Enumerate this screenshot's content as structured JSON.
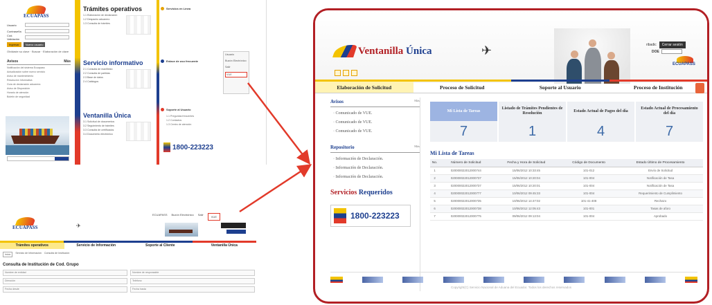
{
  "portal_left": {
    "logo_text": "ECUAPASS",
    "login_labels": [
      "Usuario",
      "Contraseña",
      "Cód. Validación"
    ],
    "buttons": [
      "Ingresar",
      "Nuevo usuario"
    ],
    "hint": "Olvidaste su clave · Buscar · Elaboración de clave",
    "avisos": {
      "title": "Avisos",
      "more": "Más",
      "items": [
        "Notificación del sistema Ecuapass",
        "Actualización sobre nuevo servicio",
        "Aviso de mantenimiento",
        "Resolución Informativa",
        "Guía de declaración aduanera",
        "Aviso de Disposición",
        "Horario de atención",
        "Boletín de seguridad"
      ]
    },
    "sections": [
      {
        "title": "Trámites operativos",
        "items": [
          "1.1 Elaboración de declaración",
          "1.2 Despacho aduanero",
          "1.3 Consulta de trámites"
        ]
      },
      {
        "title": "Servicio informativo",
        "items": [
          "2.1 Consulta de manifiesto",
          "2.2 Consulta de partidas",
          "2.3 Base de datos",
          "2.4 Catálogos"
        ]
      },
      {
        "title": "Ventanilla Única",
        "items": [
          "3.1 Solicitud de documentos",
          "3.2 Seguimiento de trámites",
          "3.3 Consulta de certificados",
          "3.4 Documento electrónico"
        ]
      }
    ],
    "right_col": [
      "Servicios en Línea",
      "Enlace de uso frecuente",
      "Soporte al Usuario",
      "1.1 Preguntas frecuentes",
      "1.2 Contactos",
      "1.3 Centro de atención"
    ],
    "phone": "1800-223223",
    "dropdown": [
      "Usuario",
      "Buzón Electrónico",
      "Salir",
      "VUE"
    ]
  },
  "portal_bottom": {
    "logo_text": "ECUAPASS",
    "login_items": [
      "ECUAPASS",
      "Buzón Electrónico",
      "Salir",
      "VUE"
    ],
    "tabs": [
      "Trámites operativos",
      "Servicio de Información",
      "Soporte al Cliente",
      "Ventanilla Única"
    ],
    "crumb": [
      "Inicio",
      "Servicio de Información",
      "Consulta de Institución"
    ],
    "title": "Consulta de Institución de Cod. Grupo",
    "fields": [
      "Nombre de entidad",
      "Nombre de responsable",
      "Dirección",
      "Teléfono",
      "Fecha desde",
      "Fecha hasta"
    ]
  },
  "vue": {
    "logo_text": "Ventanilla",
    "logo_text2": "Única",
    "user_label": "ribadic",
    "logout_button": "Cerrar sesión",
    "lang_label": "DOE",
    "mini_logo": "ECUAPASS",
    "tabs": [
      "Elaboración de Solicitud",
      "Proceso de Solicitud",
      "Soporte al Usuario",
      "Proceso de Institución"
    ],
    "avisos": {
      "title": "Avisos",
      "more": "Más",
      "items": [
        "Comunicado de VUE.",
        "Comunicado de VUE.",
        "Comunicado de VUE."
      ]
    },
    "repositorio": {
      "title": "Repositorio",
      "more": "Más",
      "items": [
        "Información de Declaración.",
        "Información de Declaración.",
        "Información de Declaración."
      ]
    },
    "servicios": {
      "title_a": "Servicios",
      "title_b": "Requeridos"
    },
    "phone": "1800-223223",
    "cards": [
      {
        "label": "Mi Lista de Tareas",
        "value": "7"
      },
      {
        "label": "Listado de Trámites Pendientes de Resolución",
        "value": "1"
      },
      {
        "label": "Estado Actual de Pagos del día",
        "value": "4"
      },
      {
        "label": "Estado Actual de Procesamiento del día",
        "value": "7"
      }
    ],
    "list_title": "Mi Lista de Tareas",
    "table": {
      "headers": [
        "No.",
        "Número de Solicitud",
        "Fecha y Hora de Solicitud",
        "Código de Documento",
        "Estado Último de Procesamiento"
      ],
      "rows": [
        [
          "1",
          "020000022012000744",
          "15/06/2012 10:33:45",
          "101-012",
          "Envío de Solicitud"
        ],
        [
          "2",
          "020000022012000737",
          "15/06/2012 10:20:04",
          "101-004",
          "Notificación de Tasa"
        ],
        [
          "3",
          "020000022012000737",
          "15/06/2012 10:20:01",
          "101-004",
          "Notificación de Tasa"
        ],
        [
          "4",
          "020000022012000777",
          "10/06/2012 09:45:33",
          "101-004",
          "Requerimiento de Cumplimiento"
        ],
        [
          "5",
          "020000022012000735",
          "10/06/2012 14:47:02",
          "101-41-408",
          "Rechazo"
        ],
        [
          "6",
          "020000022012000738",
          "10/06/2012 12:05:43",
          "101-001",
          "Tasas de aforo"
        ],
        [
          "7",
          "020000022012000775",
          "09/06/2012 09:13:04",
          "101-004",
          "Aprobado"
        ]
      ]
    },
    "copyright": "Copyright(C) Servicio Nacional de Aduana del Ecuador. Todos los derechos reservados"
  },
  "colors": {
    "yellow": "#f3c300",
    "blue": "#1d3f8f",
    "red": "#e23a2a",
    "frame": "#b21f24"
  }
}
